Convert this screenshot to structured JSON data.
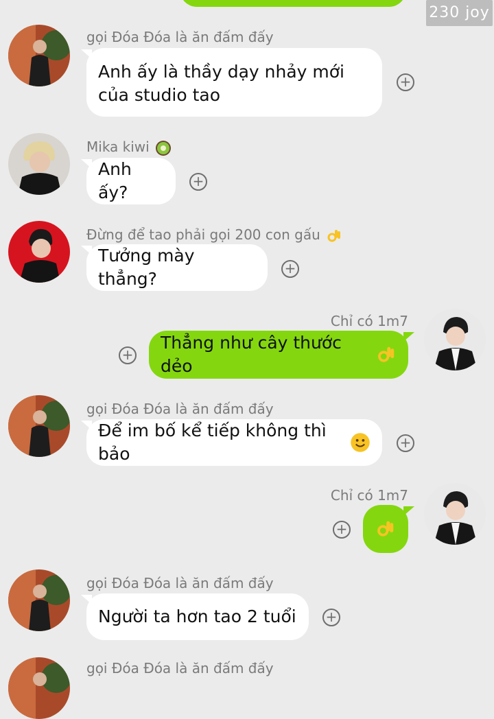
{
  "watermark": "230 joy",
  "messages": [
    {
      "sender": "gọi Đóa Đóa là ăn đấm đấy",
      "line1": "Anh ấy là thầy dạy nhảy mới",
      "line2": "của studio tao"
    },
    {
      "sender": "Mika kiwi",
      "sender_emoji": "kiwi-icon",
      "text": "Anh ấy?"
    },
    {
      "sender": "Đừng để tao phải gọi 200 con gấu",
      "sender_emoji": "ok-hand-icon",
      "text": "Tưởng mày thẳng?"
    },
    {
      "sender": "Chỉ có 1m7",
      "text": "Thẳng như cây thước dẻo",
      "text_emoji": "ok-hand-icon"
    },
    {
      "sender": "gọi Đóa Đóa là ăn đấm đấy",
      "text": "Để im bố kể tiếp không thì bảo",
      "text_emoji": "smiley-icon"
    },
    {
      "sender": "Chỉ có 1m7",
      "text_emoji": "ok-hand-icon"
    },
    {
      "sender": "gọi Đóa Đóa là ăn đấm đấy",
      "text": "Người ta hơn tao 2 tuổi"
    },
    {
      "sender": "gọi Đóa Đóa là ăn đấm đấy"
    }
  ],
  "reaction_symbol": "+",
  "colors": {
    "background": "#ebebeb",
    "sent_bubble": "#84d70f",
    "received_bubble": "#ffffff",
    "name_text": "#7a7a7a"
  }
}
